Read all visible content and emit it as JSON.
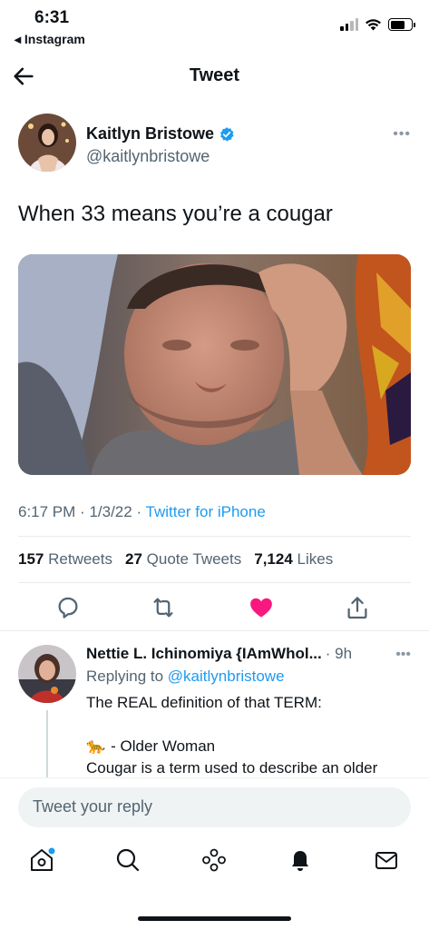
{
  "status_bar": {
    "time": "6:31",
    "back_app": "◂ Instagram",
    "signal_bars": 2,
    "battery_level": 0.7
  },
  "header": {
    "title": "Tweet"
  },
  "tweet": {
    "author_name": "Kaitlyn Bristowe",
    "author_handle": "@kaitlynbristowe",
    "verified": true,
    "text": "When 33 means you’re a cougar",
    "time": "6:17 PM",
    "date": "1/3/22",
    "client": "Twitter for iPhone",
    "retweets_count": "157",
    "retweets_label": "Retweets",
    "quotes_count": "27",
    "quotes_label": "Quote Tweets",
    "likes_count": "7,124",
    "likes_label": "Likes",
    "liked": true
  },
  "reply": {
    "author_name": "Nettie L. Ichinomiya {IAmWhol...",
    "time": "· 9h",
    "replying_prefix": "Replying to",
    "replying_to": "@kaitlynbristowe",
    "line1": "The REAL definition of that TERM:",
    "line2_emoji": "🐆",
    "line2": "- Older Woman",
    "line3": "Cougar is a term used to describe an older"
  },
  "composer": {
    "placeholder": "Tweet your reply"
  },
  "icons": {
    "back": "arrow-left-icon",
    "verified": "verified-badge-icon",
    "more": "more-horizontal-icon",
    "reply": "reply-icon",
    "retweet": "retweet-icon",
    "like": "heart-icon",
    "share": "share-icon",
    "home": "home-icon",
    "search": "search-icon",
    "spaces": "spaces-icon",
    "notifications": "bell-icon",
    "messages": "mail-icon"
  },
  "colors": {
    "accent": "#1d9bf0",
    "like": "#f91880",
    "text": "#0f1419",
    "secondary": "#536471"
  }
}
